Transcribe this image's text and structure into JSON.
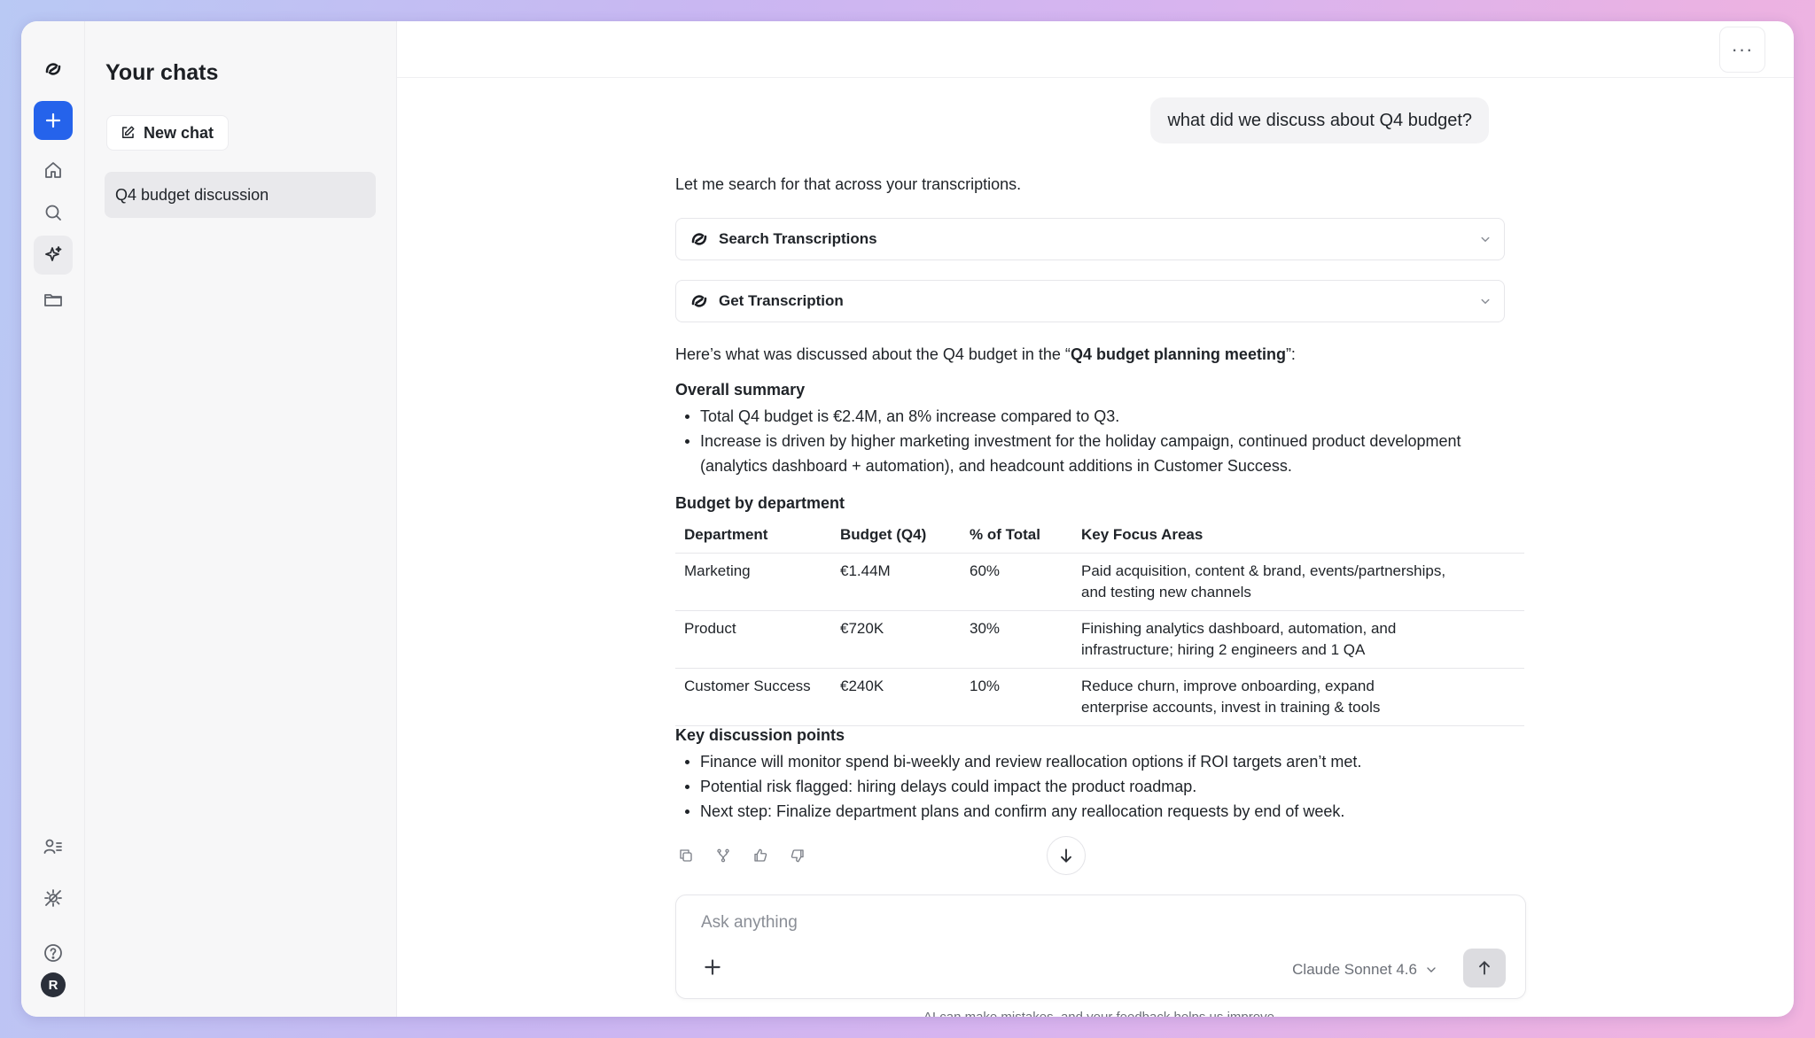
{
  "sidebar": {
    "icons": [
      "logo-icon",
      "plus-icon",
      "home-icon",
      "search-icon",
      "sparkle-icon",
      "folder-icon",
      "users-icon",
      "integrations-icon",
      "help-icon"
    ],
    "avatar_initial": "R",
    "accent_color": "#2563eb"
  },
  "chats_panel": {
    "title": "Your chats",
    "new_chat_label": "New chat",
    "items": [
      {
        "label": "Q4 budget discussion"
      }
    ]
  },
  "topbar": {
    "more_label": "···"
  },
  "conversation": {
    "user_message": "what did we discuss about Q4 budget?",
    "intro": "Let me search for that across your transcriptions.",
    "tools": [
      {
        "label": "Search Transcriptions"
      },
      {
        "label": "Get Transcription"
      }
    ],
    "summary_lead": "Here’s what was discussed about the Q4 budget in the “",
    "summary_meeting": "Q4 budget planning meeting",
    "summary_tail": "”:",
    "overall_heading": "Overall summary",
    "overall_bullets": [
      "Total Q4 budget is €2.4M, an 8% increase compared to Q3.",
      "Increase is driven by higher marketing investment for the holiday campaign, continued product development (analytics dashboard + automation), and headcount additions in Customer Success."
    ],
    "dept_heading": "Budget by department",
    "table": {
      "headers": [
        "Department",
        "Budget (Q4)",
        "% of Total",
        "Key Focus Areas"
      ],
      "rows": [
        [
          "Marketing",
          "€1.44M",
          "60%",
          "Paid acquisition, content & brand, events/partnerships, and testing new channels"
        ],
        [
          "Product",
          "€720K",
          "30%",
          "Finishing analytics dashboard, automation, and infrastructure; hiring 2 engineers and 1 QA"
        ],
        [
          "Customer Success",
          "€240K",
          "10%",
          "Reduce churn, improve onboarding, expand enterprise accounts, invest in training & tools"
        ]
      ]
    },
    "key_heading": "Key discussion points",
    "key_bullets": [
      "Finance will monitor spend bi-weekly and review reallocation options if ROI targets aren’t met.",
      "Potential risk flagged: hiring delays could impact the product roadmap.",
      "Next step: Finalize department plans and confirm any reallocation requests by end of week."
    ],
    "actions": [
      "copy-icon",
      "branch-icon",
      "thumbs-up-icon",
      "thumbs-down-icon"
    ]
  },
  "composer": {
    "placeholder": "Ask anything",
    "value": "",
    "model": "Claude Sonnet 4.6"
  },
  "disclaimer": "AI can make mistakes, and your feedback helps us improve."
}
